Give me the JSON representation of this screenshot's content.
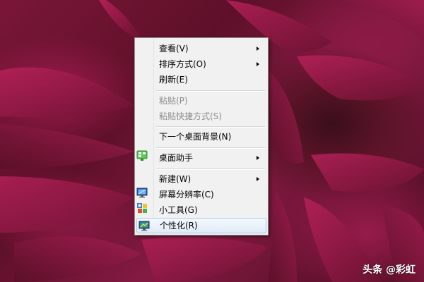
{
  "menu": {
    "items": [
      {
        "label": "查看(V)",
        "submenu": true,
        "enabled": true
      },
      {
        "label": "排序方式(O)",
        "submenu": true,
        "enabled": true
      },
      {
        "label": "刷新(E)",
        "submenu": false,
        "enabled": true
      },
      {
        "label": "粘贴(P)",
        "submenu": false,
        "enabled": false
      },
      {
        "label": "粘贴快捷方式(S)",
        "submenu": false,
        "enabled": false
      },
      {
        "label": "下一个桌面背景(N)",
        "submenu": false,
        "enabled": true
      },
      {
        "label": "桌面助手",
        "submenu": true,
        "enabled": true,
        "icon": "desktop-assistant-icon"
      },
      {
        "label": "新建(W)",
        "submenu": true,
        "enabled": true
      },
      {
        "label": "屏幕分辨率(C)",
        "submenu": false,
        "enabled": true,
        "icon": "monitor-icon"
      },
      {
        "label": "小工具(G)",
        "submenu": false,
        "enabled": true,
        "icon": "gadgets-icon"
      },
      {
        "label": "个性化(R)",
        "submenu": false,
        "enabled": true,
        "icon": "personalize-icon",
        "highlighted": true
      }
    ]
  },
  "watermark": {
    "text": "头条 @彩虹"
  },
  "colors": {
    "menu_background": "#f1f1f1",
    "menu_border": "#979797",
    "highlight_border": "#a8c8ec",
    "disabled_text": "#8d8d8d",
    "wallpaper_base": "#7a1638"
  }
}
